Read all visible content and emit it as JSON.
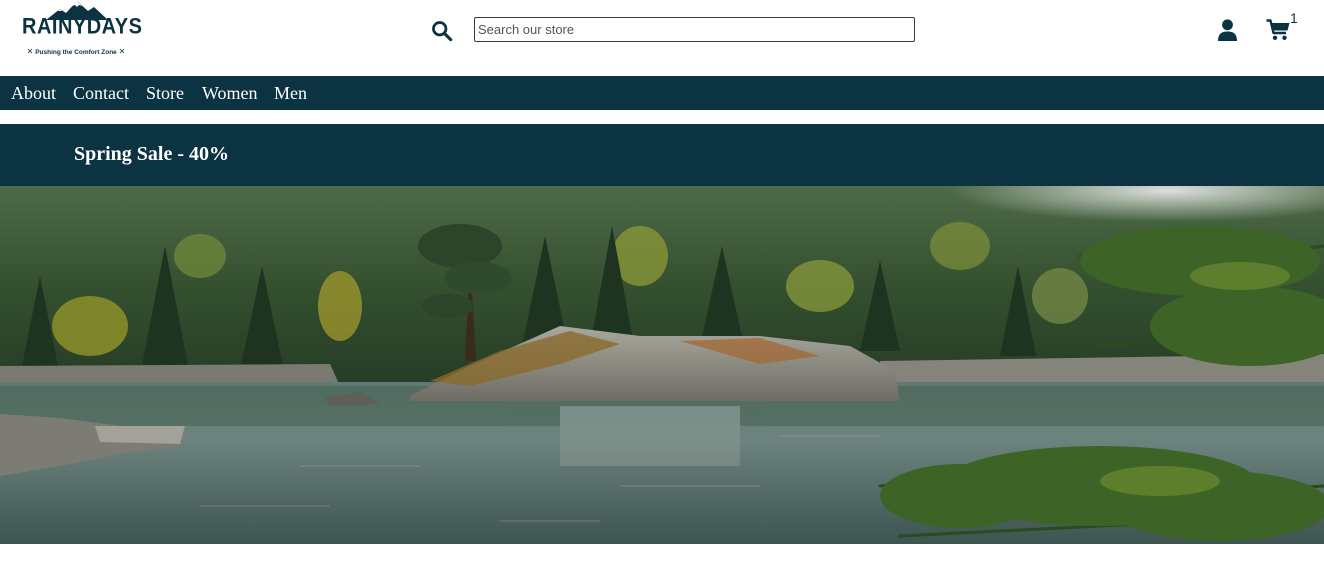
{
  "brand": {
    "name": "RAINYDAYS",
    "tagline": "Pushing the Comfort Zone",
    "tagline_mark": "✕",
    "color": "#0b3341"
  },
  "header": {
    "search": {
      "placeholder": "Search our store",
      "value": "",
      "icon": "search-icon"
    },
    "account_icon": "user-icon",
    "cart": {
      "icon": "cart-icon",
      "count": "1"
    }
  },
  "nav": {
    "items": [
      {
        "label": "About"
      },
      {
        "label": "Contact"
      },
      {
        "label": "Store"
      },
      {
        "label": "Women"
      },
      {
        "label": "Men"
      }
    ]
  },
  "sale": {
    "text": "Spring Sale - 40%"
  },
  "hero": {
    "image": "mountain-lake-forest-island"
  }
}
